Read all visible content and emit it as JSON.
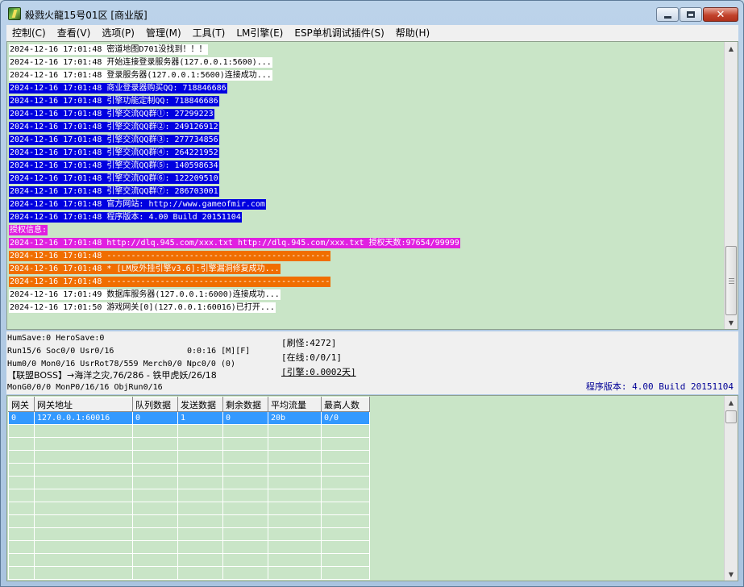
{
  "window": {
    "title": "殺戮火龍15号01区 [商业版]"
  },
  "menu": [
    "控制(C)",
    "查看(V)",
    "选项(P)",
    "管理(M)",
    "工具(T)",
    "LM引擎(E)",
    "ESP单机调试插件(S)",
    "帮助(H)"
  ],
  "log_lines": [
    {
      "style": "white",
      "text": "2024-12-16 17:01:48 密道地图D701没找到！！！"
    },
    {
      "style": "white",
      "text": "2024-12-16 17:01:48 开始连接登录服务器(127.0.0.1:5600)..."
    },
    {
      "style": "white",
      "text": "2024-12-16 17:01:48 登录服务器(127.0.0.1:5600)连接成功..."
    },
    {
      "style": "blue",
      "text": "2024-12-16 17:01:48 商业登录器购买QQ: 718846686"
    },
    {
      "style": "blue",
      "text": "2024-12-16 17:01:48 引擎功能定制QQ: 718846686"
    },
    {
      "style": "blue",
      "text": "2024-12-16 17:01:48 引擎交流QQ群①: 27299223"
    },
    {
      "style": "blue",
      "text": "2024-12-16 17:01:48 引擎交流QQ群②: 249126912"
    },
    {
      "style": "blue",
      "text": "2024-12-16 17:01:48 引擎交流QQ群③: 277734856"
    },
    {
      "style": "blue",
      "text": "2024-12-16 17:01:48 引擎交流QQ群④: 264221952"
    },
    {
      "style": "blue",
      "text": "2024-12-16 17:01:48 引擎交流QQ群⑤: 140598634"
    },
    {
      "style": "blue",
      "text": "2024-12-16 17:01:48 引擎交流QQ群⑥: 122209510"
    },
    {
      "style": "blue",
      "text": "2024-12-16 17:01:48 引擎交流QQ群⑦: 286703001"
    },
    {
      "style": "blue",
      "text": "2024-12-16 17:01:48 官方网站: http://www.gameofmir.com"
    },
    {
      "style": "blue",
      "text": "2024-12-16 17:01:48 程序版本: 4.00 Build 20151104"
    },
    {
      "style": "magenta",
      "text": "授权信息:"
    },
    {
      "style": "magenta",
      "text": "2024-12-16 17:01:48 http://dlq.945.com/xxx.txt http://dlq.945.com/xxx.txt 授权天数:97654/99999"
    },
    {
      "style": "orange",
      "text": "2024-12-16 17:01:48 ----------------------------------------------"
    },
    {
      "style": "orange",
      "text": "2024-12-16 17:01:48 * [LM反外挂引擎v3.6]:引擎漏洞修复成功..."
    },
    {
      "style": "orange",
      "text": "2024-12-16 17:01:48 ----------------------------------------------"
    },
    {
      "style": "white",
      "text": "2024-12-16 17:01:49 数据库服务器(127.0.0.1:6000)连接成功..."
    },
    {
      "style": "white",
      "text": "2024-12-16 17:01:50 游戏网关[0](127.0.0.1:60016)已打开..."
    }
  ],
  "status": {
    "line1": "HumSave:0 HeroSave:0",
    "line2": "Run15/6 Soc0/0 Usr0/16",
    "time": "0:0:16 [M][F]",
    "line3": "Hum0/0 Mon0/16 UsrRot78/559 Merch0/0 Npc0/0 (0)",
    "boss": "【联盟BOSS】→海洋之灾,76/286 - 铁甲虎妖/26/18",
    "line5": "MonG0/0/0 MonP0/16/16 ObjRun0/16",
    "refresh": "[刷怪:4272]",
    "online": "[在线:0/0/1]",
    "engine": "[引擎:0.0002天]",
    "version": "程序版本: 4.00 Build 20151104"
  },
  "grid": {
    "columns": [
      "网关",
      "网关地址",
      "队列数据",
      "发送数据",
      "剩余数据",
      "平均流量",
      "最高人数"
    ],
    "rows": [
      [
        "0",
        "127.0.0.1:60016",
        "0",
        "1",
        "0",
        "20b",
        "0/0"
      ]
    ],
    "empty_rows": 12
  }
}
